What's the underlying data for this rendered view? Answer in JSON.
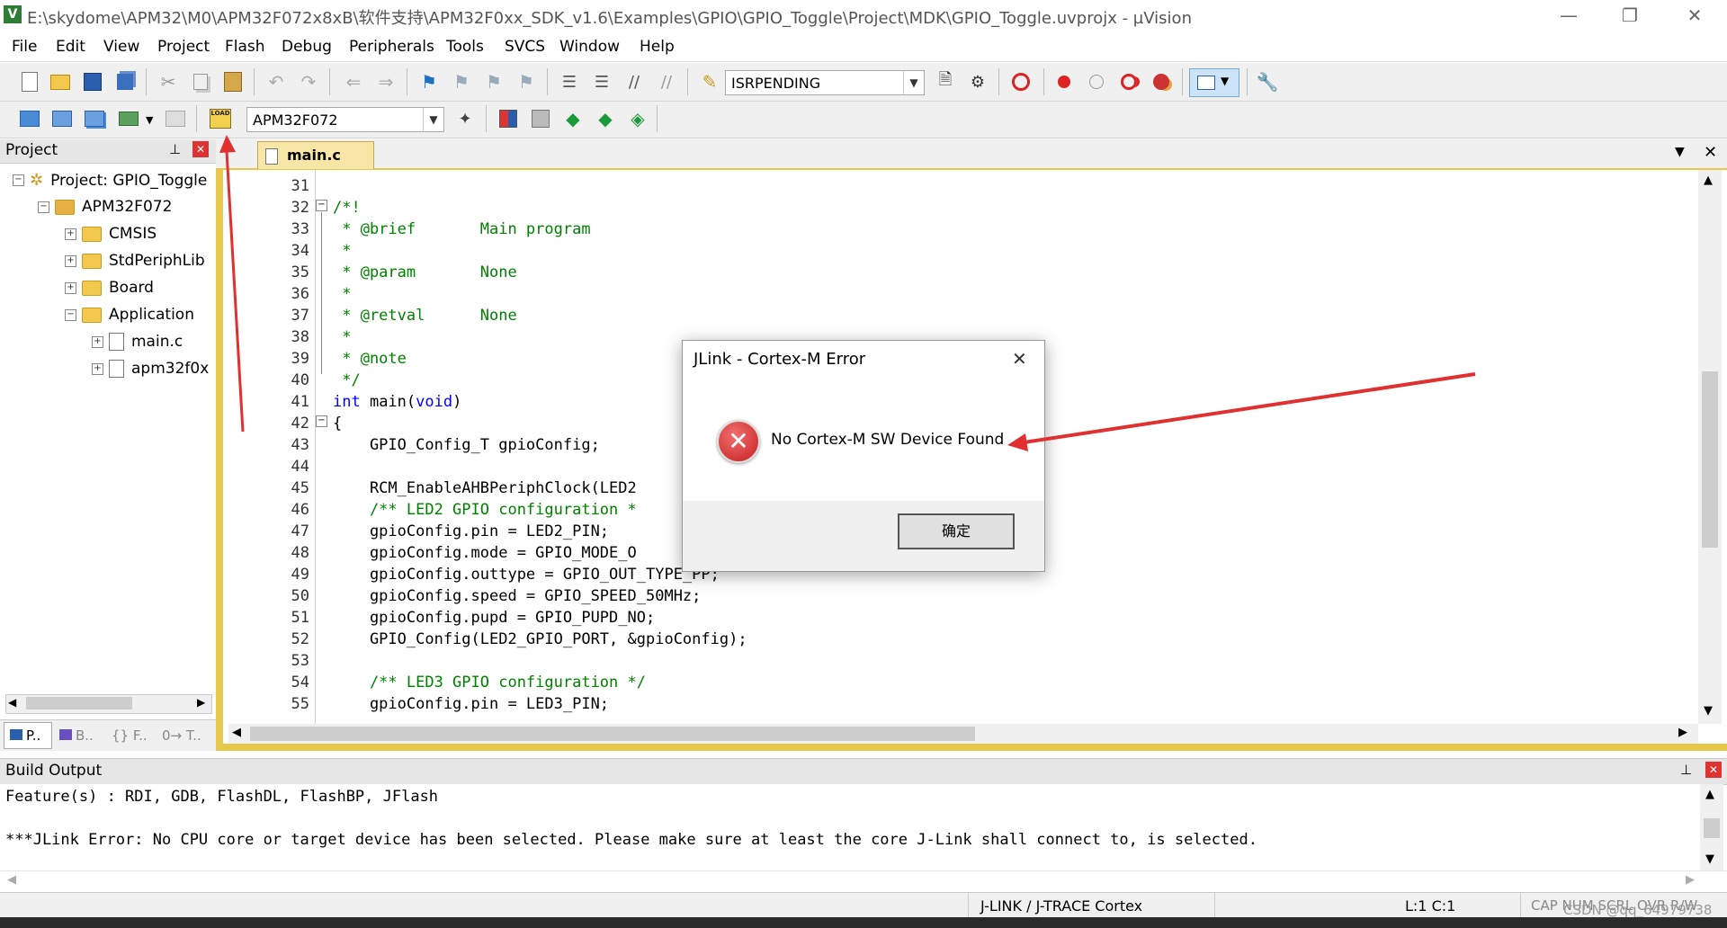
{
  "title_bar": {
    "app_icon": "uvision-icon",
    "title": "E:\\skydome\\APM32\\M0\\APM32F072x8xB\\软件支持\\APM32F0xx_SDK_v1.6\\Examples\\GPIO\\GPIO_Toggle\\Project\\MDK\\GPIO_Toggle.uvprojx - µVision",
    "minimize": "—",
    "restore": "❐",
    "close": "✕"
  },
  "menu": [
    "File",
    "Edit",
    "View",
    "Project",
    "Flash",
    "Debug",
    "Peripherals",
    "Tools",
    "SVCS",
    "Window",
    "Help"
  ],
  "toolbar1": {
    "search_value": "ISRPENDING"
  },
  "toolbar2": {
    "target_value": "APM32F072"
  },
  "project_pane": {
    "title": "Project",
    "pin": "⊥",
    "close": "✕",
    "root": "Project: GPIO_Toggle",
    "target": "APM32F072",
    "groups": [
      "CMSIS",
      "StdPeriphLib",
      "Board",
      "Application"
    ],
    "files": [
      "main.c",
      "apm32f0x"
    ],
    "tabs": [
      "P..",
      "B..",
      "{} F..",
      "0→ T.."
    ]
  },
  "editor": {
    "tab": "main.c",
    "lines": [
      {
        "n": "31",
        "t": ""
      },
      {
        "n": "32",
        "t": "/*!",
        "c": "cm"
      },
      {
        "n": "33",
        "t": " * @brief       Main program",
        "c": "cm"
      },
      {
        "n": "34",
        "t": " *",
        "c": "cm"
      },
      {
        "n": "35",
        "t": " * @param       None",
        "c": "cm"
      },
      {
        "n": "36",
        "t": " *",
        "c": "cm"
      },
      {
        "n": "37",
        "t": " * @retval      None",
        "c": "cm"
      },
      {
        "n": "38",
        "t": " *",
        "c": "cm"
      },
      {
        "n": "39",
        "t": " * @note",
        "c": "cm"
      },
      {
        "n": "40",
        "t": " */",
        "c": "cm"
      },
      {
        "n": "41",
        "t": "int main(void)",
        "c": "kw"
      },
      {
        "n": "42",
        "t": "{"
      },
      {
        "n": "43",
        "t": "    GPIO_Config_T gpioConfig;"
      },
      {
        "n": "44",
        "t": ""
      },
      {
        "n": "45",
        "t": "    RCM_EnableAHBPeriphClock(LED2"
      },
      {
        "n": "46",
        "t": "    /** LED2 GPIO configuration *",
        "c": "cm"
      },
      {
        "n": "47",
        "t": "    gpioConfig.pin = LED2_PIN;"
      },
      {
        "n": "48",
        "t": "    gpioConfig.mode = GPIO_MODE_O"
      },
      {
        "n": "49",
        "t": "    gpioConfig.outtype = GPIO_OUT_TYPE_PP;"
      },
      {
        "n": "50",
        "t": "    gpioConfig.speed = GPIO_SPEED_50MHz;"
      },
      {
        "n": "51",
        "t": "    gpioConfig.pupd = GPIO_PUPD_NO;"
      },
      {
        "n": "52",
        "t": "    GPIO_Config(LED2_GPIO_PORT, &gpioConfig);"
      },
      {
        "n": "53",
        "t": ""
      },
      {
        "n": "54",
        "t": "    /** LED3 GPIO configuration */",
        "c": "cm"
      },
      {
        "n": "55",
        "t": "    gpioConfig.pin = LED3_PIN;"
      }
    ]
  },
  "dialog": {
    "title": "JLink - Cortex-M Error",
    "message": "No Cortex-M SW Device Found",
    "ok": "确定",
    "close": "✕"
  },
  "build_output": {
    "title": "Build Output",
    "line1": "Feature(s) : RDI, GDB, FlashDL, FlashBP, JFlash",
    "line2": "***JLink Error: No CPU core or target device has been selected. Please make sure at least the core J-Link shall connect to, is selected."
  },
  "status_bar": {
    "debugger": "J-LINK / J-TRACE Cortex",
    "position": "L:1 C:1",
    "flags": "CAP  NUM  SCRL  OVR  R/W",
    "watermark": "CSDN @qq_64979738"
  },
  "colors": {
    "comment": "#008000",
    "keyword": "#0000ff",
    "annotation_arrow": "#e03030",
    "error_icon": "#d93030"
  }
}
